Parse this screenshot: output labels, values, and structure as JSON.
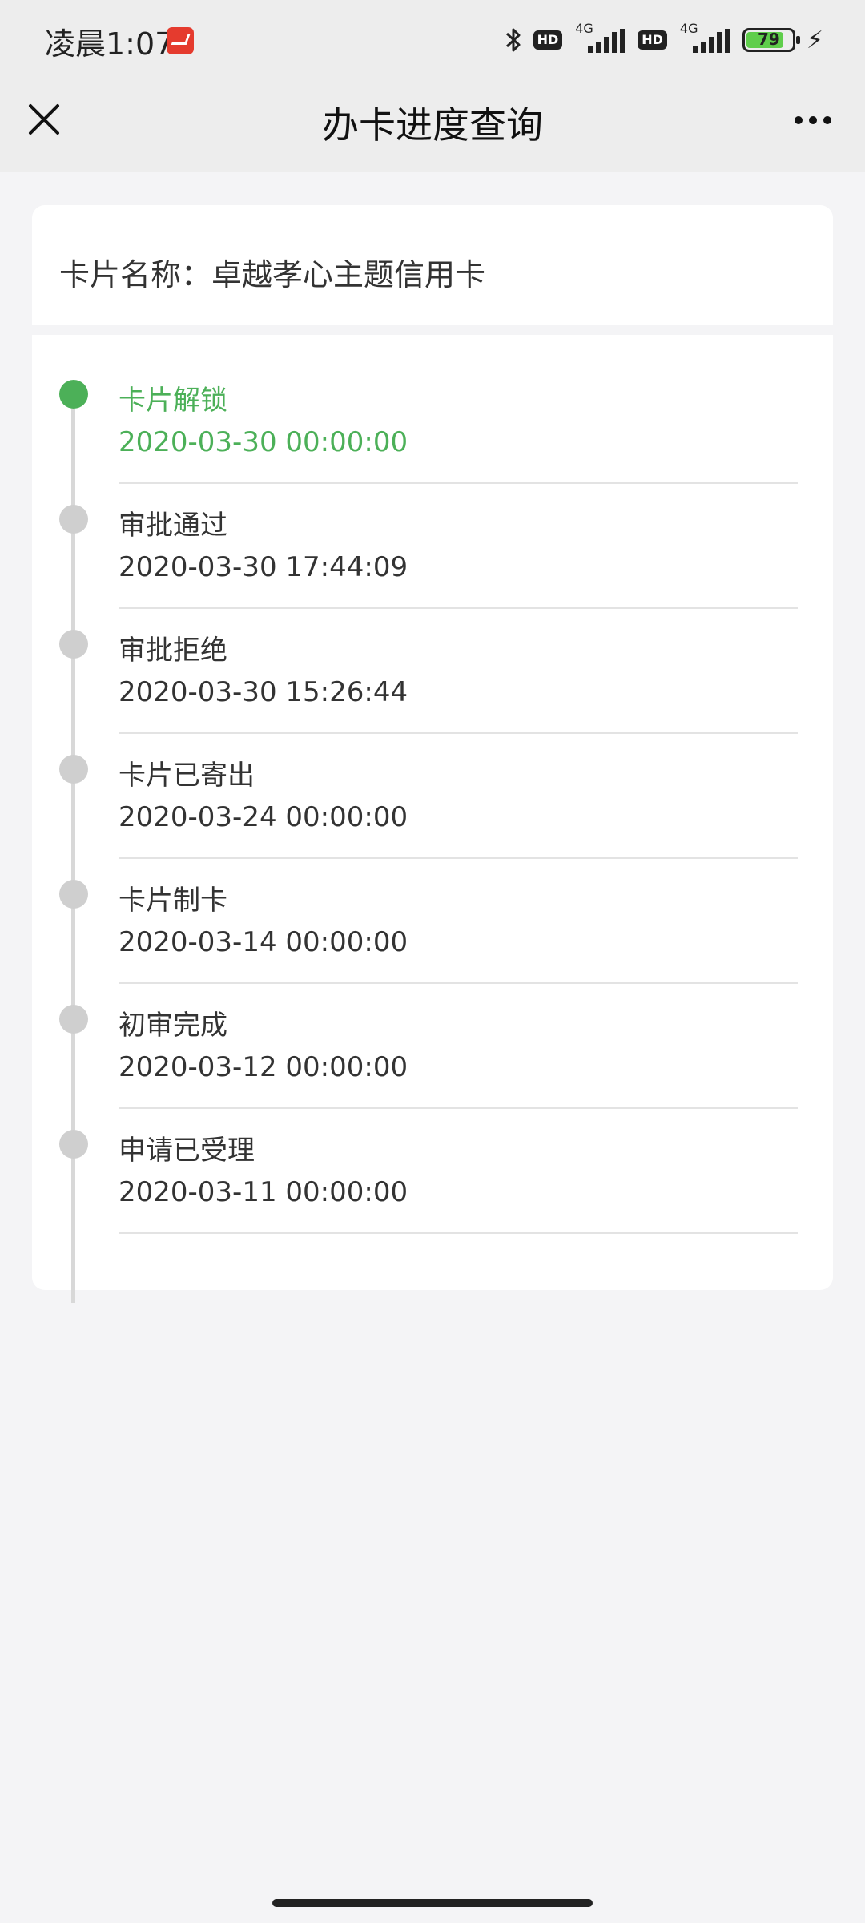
{
  "status_bar": {
    "time": "凌晨1:07",
    "hd_badge": "HD",
    "network_1": "4G",
    "network_2": "4G",
    "battery_level": "79"
  },
  "nav": {
    "title": "办卡进度查询"
  },
  "card": {
    "name_label": "卡片名称：卓越孝心主题信用卡"
  },
  "timeline": [
    {
      "label": "卡片解锁",
      "time": "2020-03-30 00:00:00",
      "active": true
    },
    {
      "label": "审批通过",
      "time": "2020-03-30 17:44:09",
      "active": false
    },
    {
      "label": "审批拒绝",
      "time": "2020-03-30 15:26:44",
      "active": false
    },
    {
      "label": "卡片已寄出",
      "time": "2020-03-24 00:00:00",
      "active": false
    },
    {
      "label": "卡片制卡",
      "time": "2020-03-14 00:00:00",
      "active": false
    },
    {
      "label": "初审完成",
      "time": "2020-03-12 00:00:00",
      "active": false
    },
    {
      "label": "申请已受理",
      "time": "2020-03-11 00:00:00",
      "active": false
    }
  ],
  "colors": {
    "active": "#4cb058",
    "inactive_dot": "#cfcfcf",
    "background": "#f4f4f6"
  }
}
